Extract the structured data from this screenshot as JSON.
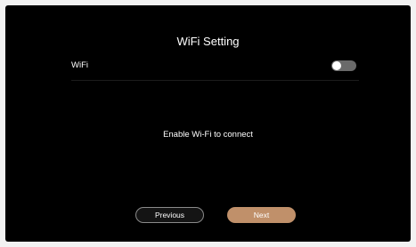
{
  "title": "WiFi Setting",
  "wifi": {
    "label": "WiFi",
    "enabled": false
  },
  "message": "Enable Wi-Fi to connect",
  "buttons": {
    "previous": "Previous",
    "next": "Next"
  },
  "colors": {
    "background": "#000000",
    "accent": "#c0906a",
    "toggle_off": "#6a6a6a"
  }
}
